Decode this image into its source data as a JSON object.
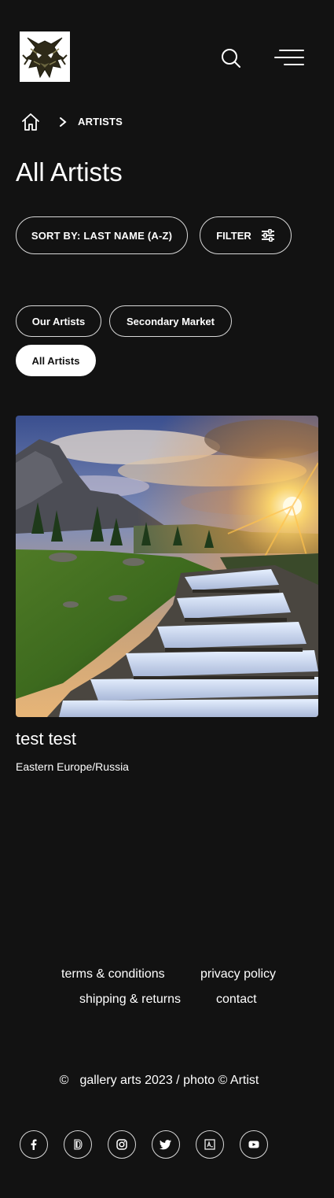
{
  "header": {
    "logo_icon": "wolf-head-logo",
    "search_icon": "search-icon",
    "menu_icon": "hamburger-menu-icon"
  },
  "breadcrumb": {
    "home_icon": "home-icon",
    "separator_icon": "chevron-right-icon",
    "current": "ARTISTS"
  },
  "page": {
    "title": "All Artists"
  },
  "controls": {
    "sort_label": "SORT BY: LAST NAME (A-Z)",
    "filter_label": "FILTER",
    "filter_icon": "sliders-icon"
  },
  "tabs": [
    {
      "label": "Our Artists",
      "active": false
    },
    {
      "label": "Secondary Market",
      "active": false
    },
    {
      "label": "All Artists",
      "active": true
    }
  ],
  "artists": [
    {
      "name": "test test",
      "region": "Eastern Europe/Russia",
      "image": "mountain-waterfall-sunset-photo"
    }
  ],
  "footer": {
    "links": {
      "terms": "terms & conditions",
      "privacy": "privacy policy",
      "shipping": "shipping & returns",
      "contact": "contact"
    },
    "copyright_symbol": "©",
    "copyright_text": "gallery arts 2023 / photo © Artist",
    "social": [
      "facebook-icon",
      "deviantart-icon",
      "instagram-icon",
      "twitter-icon",
      "artstation-icon",
      "youtube-icon"
    ]
  },
  "colors": {
    "background": "#121212",
    "text": "#ffffff",
    "border": "#d8d8d8",
    "active_tab_bg": "#ffffff",
    "active_tab_text": "#111111"
  }
}
